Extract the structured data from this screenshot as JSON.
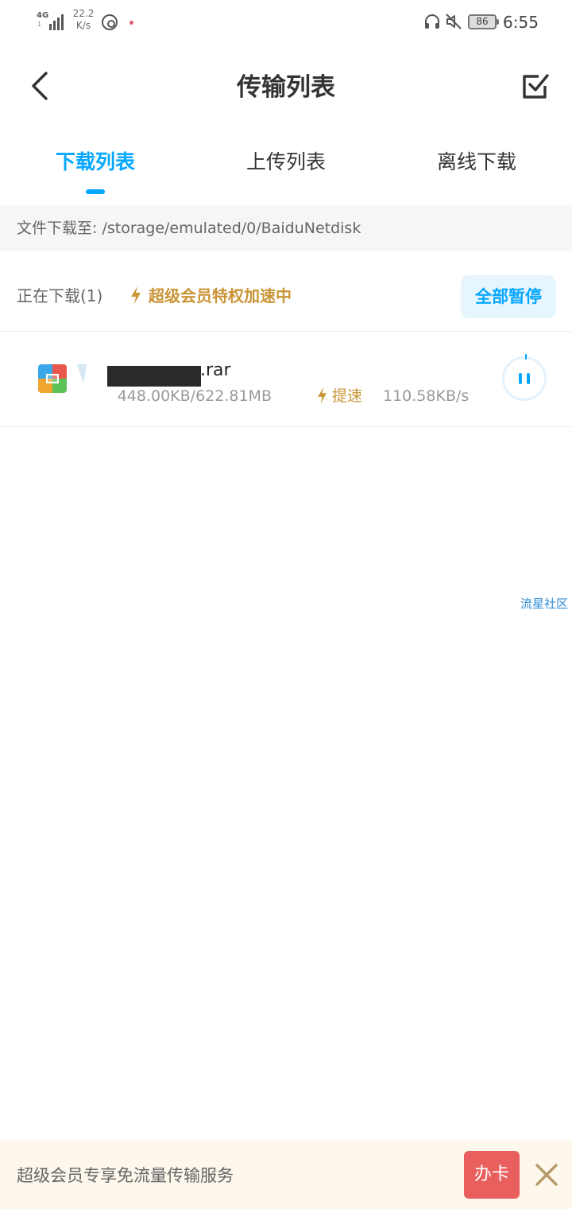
{
  "status_bar": {
    "network_type": "4G",
    "network_sub": "1",
    "net_speed_value": "22.2",
    "net_speed_unit": "K/s",
    "battery_level": "86",
    "time": "6:55"
  },
  "header": {
    "title": "传输列表"
  },
  "tabs": [
    {
      "label": "下载列表",
      "active": true
    },
    {
      "label": "上传列表",
      "active": false
    },
    {
      "label": "离线下载",
      "active": false
    }
  ],
  "path_bar": {
    "text": "文件下载至: /storage/emulated/0/BaiduNetdisk"
  },
  "section": {
    "downloading_label": "正在下载(1)",
    "vip_label": "超级会员特权加速中",
    "pause_all_label": "全部暂停"
  },
  "download_item": {
    "file_name_suffix": ".rar",
    "progress": "448.00KB/622.81MB",
    "boost_label": "提速",
    "speed": "110.58KB/s"
  },
  "watermark": "流星社区",
  "banner": {
    "text": "超级会员专享免流量传输服务",
    "button_label": "办卡"
  },
  "colors": {
    "accent": "#06a7ff",
    "vip_gold": "#c99536",
    "banner_bg": "#fdf7ec",
    "card_button": "#e95f5e"
  },
  "icons": {
    "back": "chevron-left-icon",
    "edit": "checkbox-edit-icon",
    "bolt": "lightning-icon",
    "archive": "rar-archive-icon",
    "pause": "pause-icon",
    "close": "close-icon"
  }
}
